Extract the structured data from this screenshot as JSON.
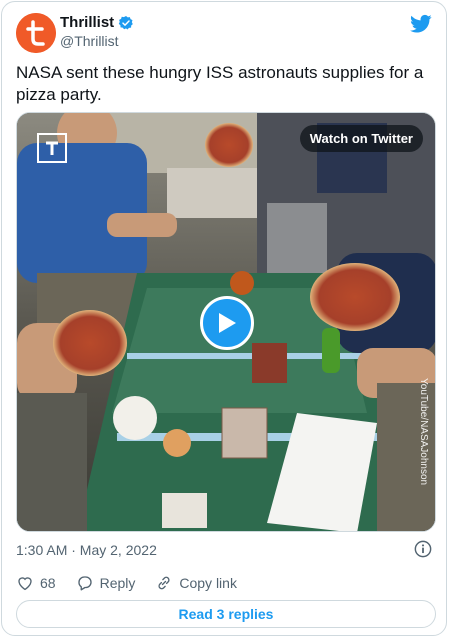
{
  "author": {
    "name": "Thrillist",
    "handle": "@Thrillist",
    "avatar_letter": "t",
    "brand_color": "#f05a28",
    "verified_color": "#1d9bf0"
  },
  "tweet": {
    "text": "NASA sent these hungry ISS astronauts supplies for a pizza party."
  },
  "media": {
    "watch_label": "Watch on Twitter",
    "credit": "YouTube/NASAJohnson",
    "play_icon": "play-icon"
  },
  "meta": {
    "timestamp": "1:30 AM · May 2, 2022"
  },
  "actions": {
    "like_count": "68",
    "reply_label": "Reply",
    "copy_label": "Copy link"
  },
  "replies": {
    "label": "Read 3 replies"
  },
  "colors": {
    "accent": "#1d9bf0",
    "muted": "#536471",
    "border": "#cfd9de"
  }
}
